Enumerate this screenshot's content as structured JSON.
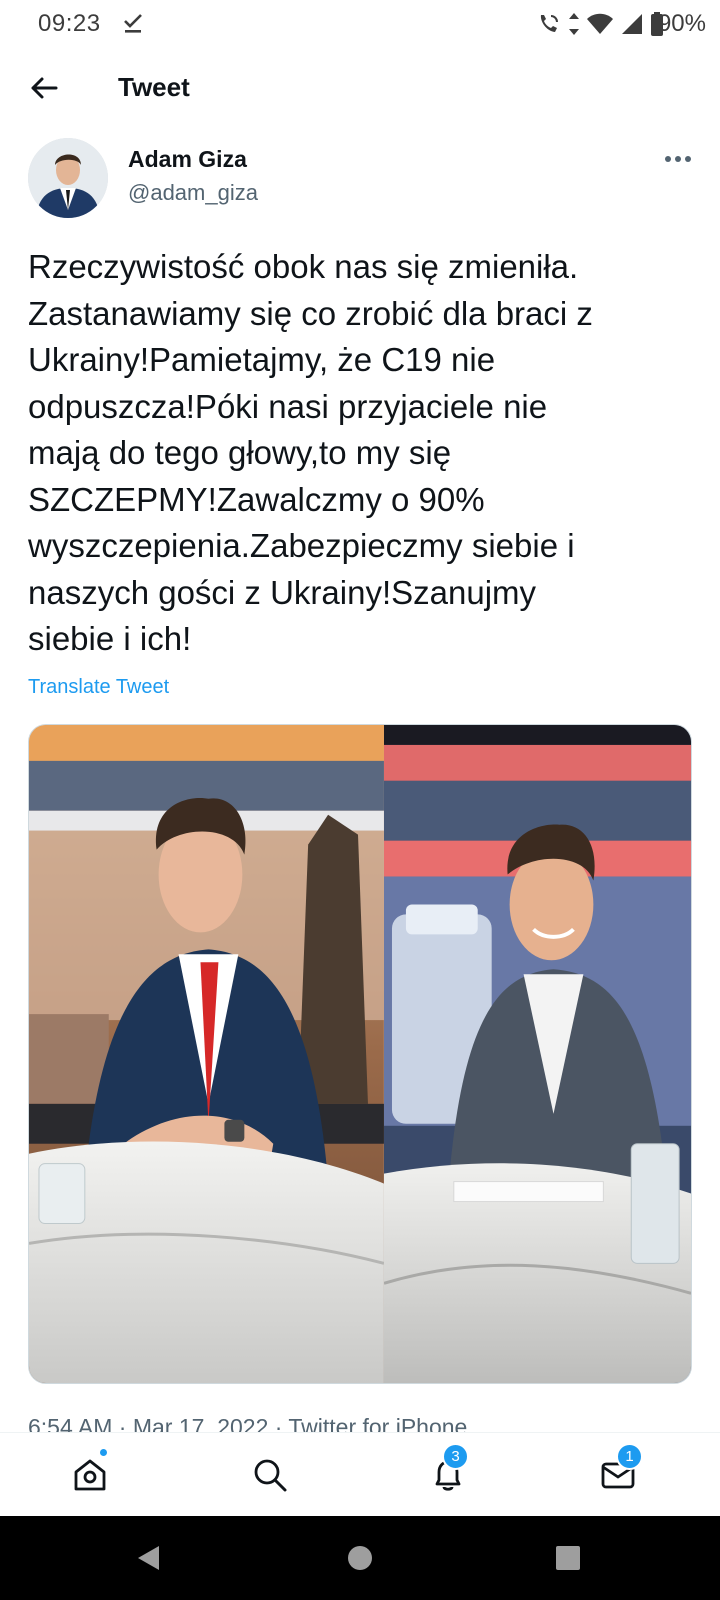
{
  "status_bar": {
    "time": "09:23",
    "battery": "90%",
    "icons": [
      "download-done-icon",
      "wifi-calling-icon",
      "data-arrows-icon",
      "wifi-icon",
      "cellular-signal-icon",
      "battery-icon"
    ]
  },
  "header": {
    "title": "Tweet",
    "back_icon": "arrow-left-icon"
  },
  "tweet": {
    "author_name": "Adam Giza",
    "author_handle": "@adam_giza",
    "more_icon": "more-horizontal-icon",
    "text_lines": [
      "Rzeczywistość obok nas się zmieniła.",
      "Zastanawiamy się co zrobić dla braci z",
      "Ukrainy!Pamietajmy, że C19 nie",
      "odpuszcza!Póki nasi przyjaciele nie",
      "mają do tego głowy,to my się",
      "SZCZEPMY!Zawalczmy o 90%",
      "wyszczepienia.Zabezpieczmy siebie i",
      "naszych gości z Ukrainy!Szanujmy",
      "siebie i ich!"
    ],
    "translate": "Translate Tweet",
    "meta": "6:54 AM · Mar 17, 2022 · Twitter for iPhone"
  },
  "bottom_nav": {
    "home_icon": "home-icon",
    "search_icon": "search-icon",
    "notifications_icon": "bell-icon",
    "notifications_badge": "3",
    "messages_icon": "mail-icon",
    "messages_badge": "1"
  },
  "system_nav": [
    "back-triangle-icon",
    "home-circle-icon",
    "recents-square-icon"
  ],
  "colors": {
    "accent": "#1d9bf0",
    "text_primary": "#0f1419",
    "text_secondary": "#536471"
  }
}
